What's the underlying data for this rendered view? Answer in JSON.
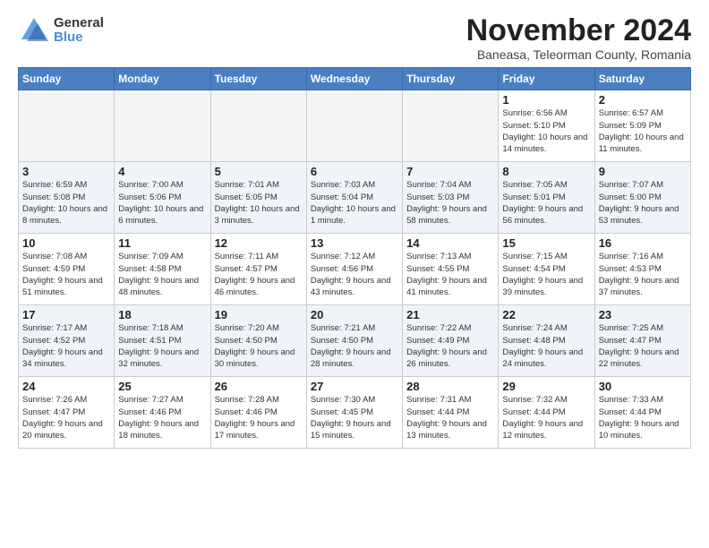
{
  "logo": {
    "general": "General",
    "blue": "Blue"
  },
  "header": {
    "month": "November 2024",
    "location": "Baneasa, Teleorman County, Romania"
  },
  "days_of_week": [
    "Sunday",
    "Monday",
    "Tuesday",
    "Wednesday",
    "Thursday",
    "Friday",
    "Saturday"
  ],
  "weeks": [
    [
      {
        "day": "",
        "info": ""
      },
      {
        "day": "",
        "info": ""
      },
      {
        "day": "",
        "info": ""
      },
      {
        "day": "",
        "info": ""
      },
      {
        "day": "",
        "info": ""
      },
      {
        "day": "1",
        "info": "Sunrise: 6:56 AM\nSunset: 5:10 PM\nDaylight: 10 hours and 14 minutes."
      },
      {
        "day": "2",
        "info": "Sunrise: 6:57 AM\nSunset: 5:09 PM\nDaylight: 10 hours and 11 minutes."
      }
    ],
    [
      {
        "day": "3",
        "info": "Sunrise: 6:59 AM\nSunset: 5:08 PM\nDaylight: 10 hours and 8 minutes."
      },
      {
        "day": "4",
        "info": "Sunrise: 7:00 AM\nSunset: 5:06 PM\nDaylight: 10 hours and 6 minutes."
      },
      {
        "day": "5",
        "info": "Sunrise: 7:01 AM\nSunset: 5:05 PM\nDaylight: 10 hours and 3 minutes."
      },
      {
        "day": "6",
        "info": "Sunrise: 7:03 AM\nSunset: 5:04 PM\nDaylight: 10 hours and 1 minute."
      },
      {
        "day": "7",
        "info": "Sunrise: 7:04 AM\nSunset: 5:03 PM\nDaylight: 9 hours and 58 minutes."
      },
      {
        "day": "8",
        "info": "Sunrise: 7:05 AM\nSunset: 5:01 PM\nDaylight: 9 hours and 56 minutes."
      },
      {
        "day": "9",
        "info": "Sunrise: 7:07 AM\nSunset: 5:00 PM\nDaylight: 9 hours and 53 minutes."
      }
    ],
    [
      {
        "day": "10",
        "info": "Sunrise: 7:08 AM\nSunset: 4:59 PM\nDaylight: 9 hours and 51 minutes."
      },
      {
        "day": "11",
        "info": "Sunrise: 7:09 AM\nSunset: 4:58 PM\nDaylight: 9 hours and 48 minutes."
      },
      {
        "day": "12",
        "info": "Sunrise: 7:11 AM\nSunset: 4:57 PM\nDaylight: 9 hours and 46 minutes."
      },
      {
        "day": "13",
        "info": "Sunrise: 7:12 AM\nSunset: 4:56 PM\nDaylight: 9 hours and 43 minutes."
      },
      {
        "day": "14",
        "info": "Sunrise: 7:13 AM\nSunset: 4:55 PM\nDaylight: 9 hours and 41 minutes."
      },
      {
        "day": "15",
        "info": "Sunrise: 7:15 AM\nSunset: 4:54 PM\nDaylight: 9 hours and 39 minutes."
      },
      {
        "day": "16",
        "info": "Sunrise: 7:16 AM\nSunset: 4:53 PM\nDaylight: 9 hours and 37 minutes."
      }
    ],
    [
      {
        "day": "17",
        "info": "Sunrise: 7:17 AM\nSunset: 4:52 PM\nDaylight: 9 hours and 34 minutes."
      },
      {
        "day": "18",
        "info": "Sunrise: 7:18 AM\nSunset: 4:51 PM\nDaylight: 9 hours and 32 minutes."
      },
      {
        "day": "19",
        "info": "Sunrise: 7:20 AM\nSunset: 4:50 PM\nDaylight: 9 hours and 30 minutes."
      },
      {
        "day": "20",
        "info": "Sunrise: 7:21 AM\nSunset: 4:50 PM\nDaylight: 9 hours and 28 minutes."
      },
      {
        "day": "21",
        "info": "Sunrise: 7:22 AM\nSunset: 4:49 PM\nDaylight: 9 hours and 26 minutes."
      },
      {
        "day": "22",
        "info": "Sunrise: 7:24 AM\nSunset: 4:48 PM\nDaylight: 9 hours and 24 minutes."
      },
      {
        "day": "23",
        "info": "Sunrise: 7:25 AM\nSunset: 4:47 PM\nDaylight: 9 hours and 22 minutes."
      }
    ],
    [
      {
        "day": "24",
        "info": "Sunrise: 7:26 AM\nSunset: 4:47 PM\nDaylight: 9 hours and 20 minutes."
      },
      {
        "day": "25",
        "info": "Sunrise: 7:27 AM\nSunset: 4:46 PM\nDaylight: 9 hours and 18 minutes."
      },
      {
        "day": "26",
        "info": "Sunrise: 7:28 AM\nSunset: 4:46 PM\nDaylight: 9 hours and 17 minutes."
      },
      {
        "day": "27",
        "info": "Sunrise: 7:30 AM\nSunset: 4:45 PM\nDaylight: 9 hours and 15 minutes."
      },
      {
        "day": "28",
        "info": "Sunrise: 7:31 AM\nSunset: 4:44 PM\nDaylight: 9 hours and 13 minutes."
      },
      {
        "day": "29",
        "info": "Sunrise: 7:32 AM\nSunset: 4:44 PM\nDaylight: 9 hours and 12 minutes."
      },
      {
        "day": "30",
        "info": "Sunrise: 7:33 AM\nSunset: 4:44 PM\nDaylight: 9 hours and 10 minutes."
      }
    ]
  ]
}
